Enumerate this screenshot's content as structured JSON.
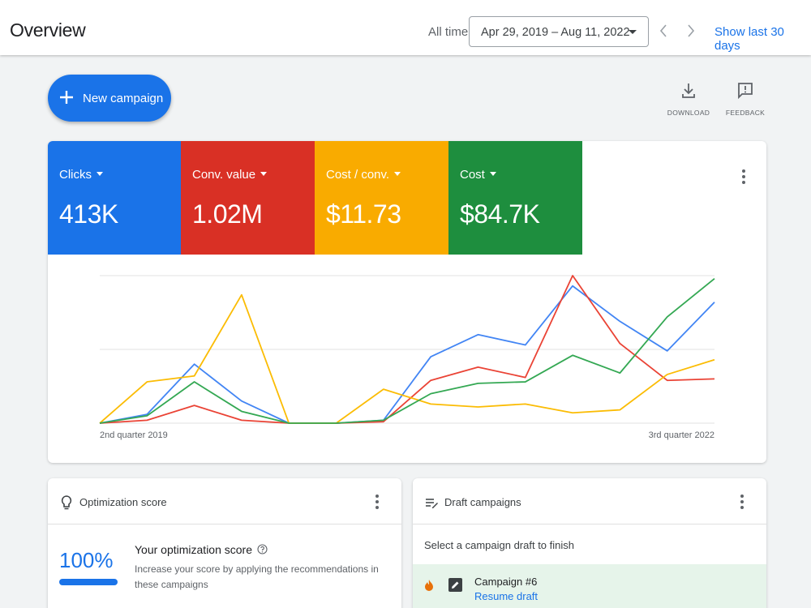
{
  "header": {
    "title": "Overview",
    "all_time_label": "All time",
    "date_range": "Apr 29, 2019 – Aug 11, 2022",
    "show_last_label": "Show last 30 days"
  },
  "actions": {
    "new_campaign_label": "New campaign",
    "download_label": "DOWNLOAD",
    "feedback_label": "FEEDBACK"
  },
  "metrics": [
    {
      "label": "Clicks",
      "value": "413K",
      "color": "#1a73e8"
    },
    {
      "label": "Conv. value",
      "value": "1.02M",
      "color": "#d93025"
    },
    {
      "label": "Cost / conv.",
      "value": "$11.73",
      "color": "#f9ab00"
    },
    {
      "label": "Cost",
      "value": "$84.7K",
      "color": "#1e8e3e"
    }
  ],
  "chart_data": {
    "type": "line",
    "x_tick_labels": [
      "2nd quarter 2019",
      "3rd quarter 2022"
    ],
    "x": [
      0,
      1,
      2,
      3,
      4,
      5,
      6,
      7,
      8,
      9,
      10,
      11,
      12,
      13
    ],
    "ylim": [
      0,
      100
    ],
    "grid": true,
    "series": [
      {
        "color": "#4285f4",
        "values": [
          0,
          6,
          40,
          15,
          0,
          0,
          2,
          45,
          60,
          53,
          93,
          69,
          49,
          82
        ]
      },
      {
        "color": "#ea4335",
        "values": [
          0,
          2,
          12,
          2,
          0,
          0,
          1,
          29,
          38,
          31,
          100,
          54,
          29,
          30
        ]
      },
      {
        "color": "#fbbc04",
        "values": [
          0,
          28,
          32,
          87,
          0,
          0,
          23,
          13,
          11,
          13,
          7,
          9,
          33,
          43
        ]
      },
      {
        "color": "#34a853",
        "values": [
          0,
          5,
          28,
          8,
          0,
          0,
          2,
          20,
          27,
          28,
          46,
          34,
          72,
          98
        ]
      }
    ]
  },
  "optimization": {
    "title": "Optimization score",
    "score": "100%",
    "score_fraction": 1.0,
    "heading": "Your optimization score",
    "description": "Increase your score by applying the recommendations in these campaigns"
  },
  "drafts": {
    "title": "Draft campaigns",
    "instruction": "Select a campaign draft to finish",
    "items": [
      {
        "name": "Campaign #6",
        "action": "Resume draft"
      }
    ]
  }
}
